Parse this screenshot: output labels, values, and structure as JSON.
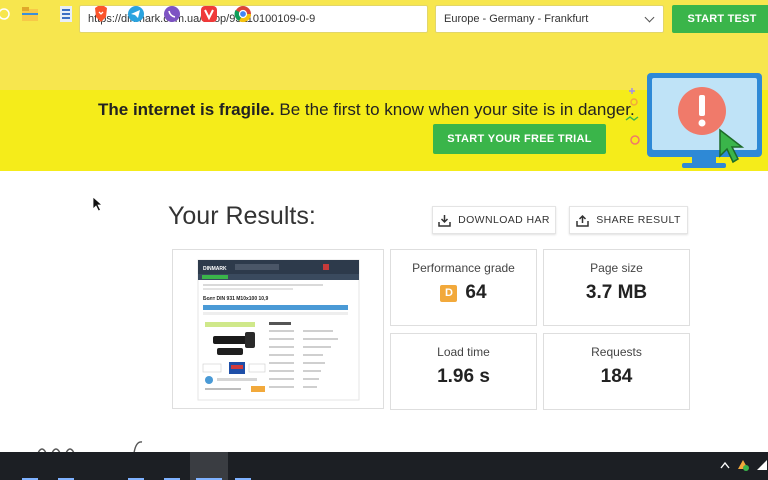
{
  "test_form": {
    "url_value": "https://dinmark.com.ua/shop/93110100109-0-9",
    "location": "Europe - Germany - Frankfurt",
    "start_label": "START TEST"
  },
  "promo": {
    "bold": "The internet is fragile.",
    "rest": " Be the first to know when your site is in danger.",
    "cta": "START YOUR FREE TRIAL"
  },
  "results": {
    "title": "Your Results:",
    "download_har": "DOWNLOAD HAR",
    "share_result": "SHARE RESULT",
    "metrics": [
      {
        "label": "Performance grade",
        "grade": "D",
        "value": "64"
      },
      {
        "label": "Page size",
        "value": "3.7 MB"
      },
      {
        "label": "Load time",
        "value": "1.96 s"
      },
      {
        "label": "Requests",
        "value": "184"
      }
    ]
  },
  "screenshot_preview": {
    "logo": "DINMARK",
    "product_title": "Болт DIN 931 M10x100 10,9"
  },
  "colors": {
    "test_bar": "#f7e64e",
    "promo_bar": "#f5ec1a",
    "accent_green": "#3ab54a",
    "grade_d": "#f2a93b",
    "taskbar": "#1c1f24"
  },
  "taskbar_icons": [
    "windows-start-icon",
    "file-explorer-icon",
    "app-icon",
    "brave-browser-icon",
    "telegram-icon",
    "viber-icon",
    "vivaldi-icon",
    "chrome-icon"
  ]
}
